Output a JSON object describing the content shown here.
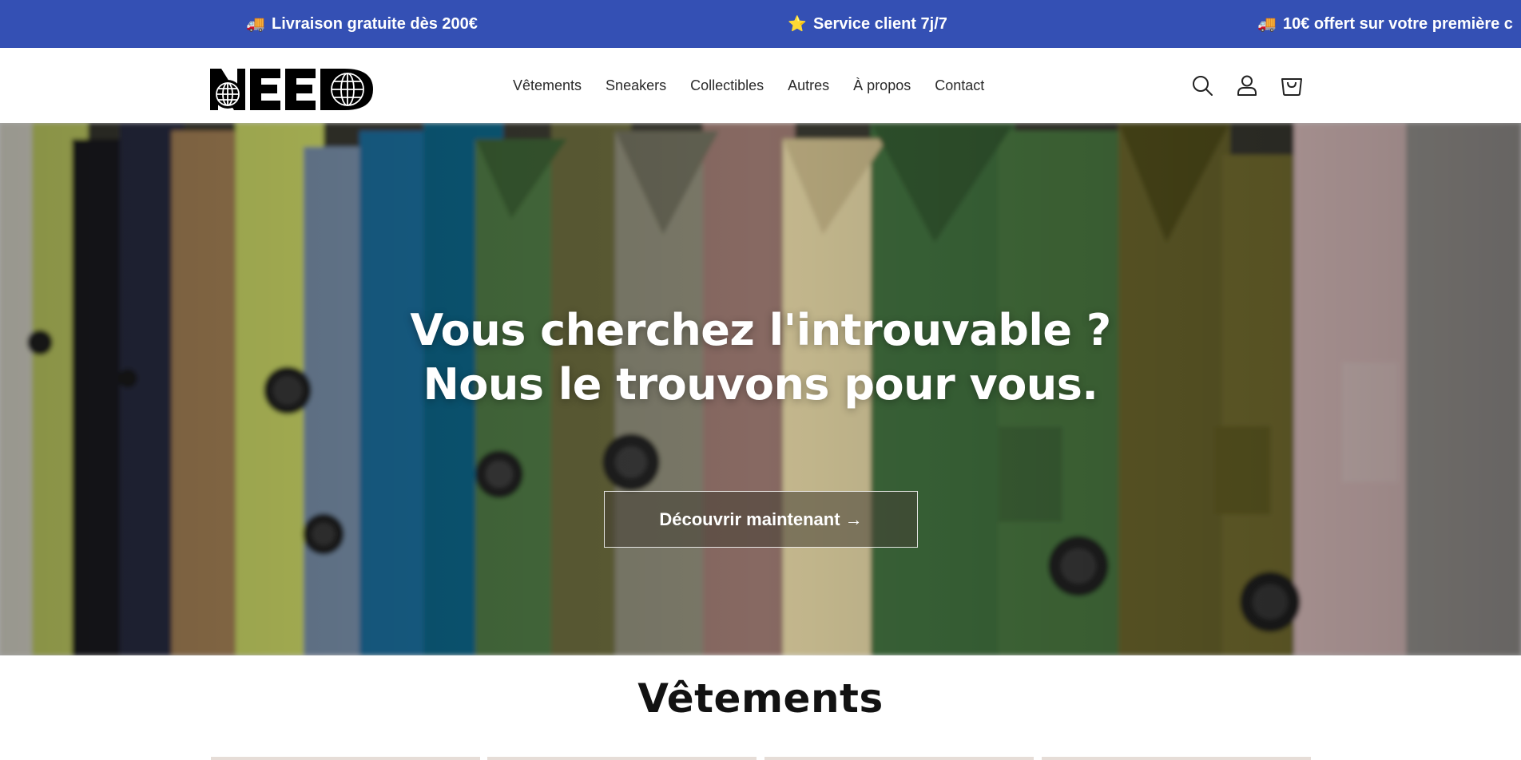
{
  "announcement": {
    "items": [
      {
        "icon": "delivery-truck-icon",
        "emoji": "🚚",
        "text": "Livraison gratuite dès 200€"
      },
      {
        "icon": "star-icon",
        "emoji": "⭐",
        "text": "Service client 7j/7"
      },
      {
        "icon": "delivery-truck-icon",
        "emoji": "🚚",
        "text": "10€ offert sur votre première c"
      }
    ],
    "bg_color": "#3450b4"
  },
  "header": {
    "logo_alt": "NEED",
    "nav": [
      "Vêtements",
      "Sneakers",
      "Collectibles",
      "Autres",
      "À propos",
      "Contact"
    ],
    "icons": [
      "search-icon",
      "account-icon",
      "cart-icon"
    ]
  },
  "hero": {
    "title_line1": "Vous cherchez l'introuvable ?",
    "title_line2": "Nous le trouvons pour vous.",
    "button_label": "Découvrir maintenant →"
  },
  "section": {
    "title": "Vêtements"
  }
}
